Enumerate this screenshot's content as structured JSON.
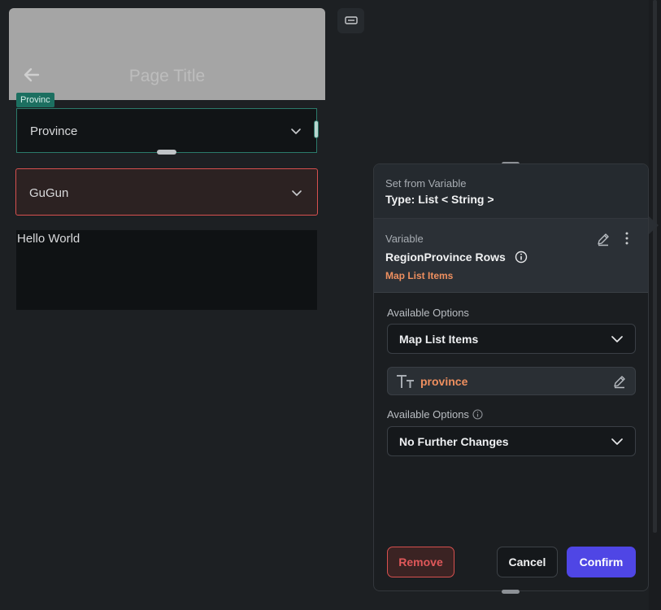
{
  "canvas": {
    "page_title": "Page Title",
    "province_tag": "Provinc",
    "province_dropdown": "Province",
    "gugun_dropdown": "GuGun",
    "text_widget": "Hello World"
  },
  "panel": {
    "header_sub": "Set from Variable",
    "header_type": "Type: List < String >",
    "variable_label": "Variable",
    "variable_name": "RegionProvince Rows",
    "variable_link": "Map List Items",
    "options1_label": "Available Options",
    "options1_value": "Map List Items",
    "property_value": "province",
    "options2_label": "Available Options",
    "options2_value": "No Further Changes",
    "remove_label": "Remove",
    "cancel_label": "Cancel",
    "confirm_label": "Confirm"
  },
  "colors": {
    "accent": "#4f46e5",
    "danger": "#d7504f",
    "highlight": "#ee8f5f",
    "selection": "#2b7a6a"
  }
}
